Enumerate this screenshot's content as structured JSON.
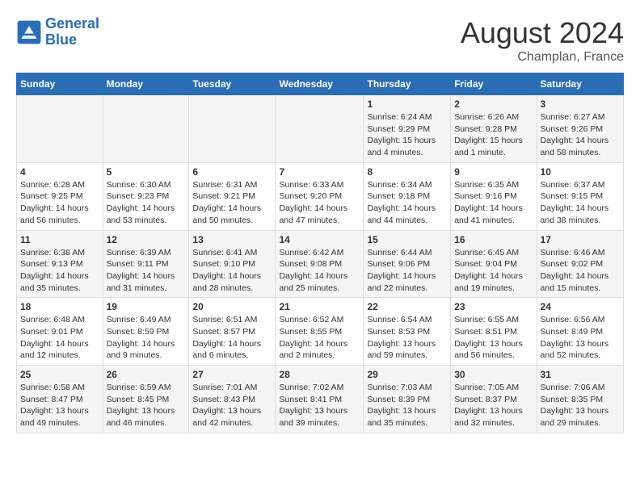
{
  "header": {
    "logo_line1": "General",
    "logo_line2": "Blue",
    "main_title": "August 2024",
    "subtitle": "Champlan, France"
  },
  "days_of_week": [
    "Sunday",
    "Monday",
    "Tuesday",
    "Wednesday",
    "Thursday",
    "Friday",
    "Saturday"
  ],
  "weeks": [
    [
      {
        "day": "",
        "info": ""
      },
      {
        "day": "",
        "info": ""
      },
      {
        "day": "",
        "info": ""
      },
      {
        "day": "",
        "info": ""
      },
      {
        "day": "1",
        "info": "Sunrise: 6:24 AM\nSunset: 9:29 PM\nDaylight: 15 hours\nand 4 minutes."
      },
      {
        "day": "2",
        "info": "Sunrise: 6:26 AM\nSunset: 9:28 PM\nDaylight: 15 hours\nand 1 minute."
      },
      {
        "day": "3",
        "info": "Sunrise: 6:27 AM\nSunset: 9:26 PM\nDaylight: 14 hours\nand 58 minutes."
      }
    ],
    [
      {
        "day": "4",
        "info": "Sunrise: 6:28 AM\nSunset: 9:25 PM\nDaylight: 14 hours\nand 56 minutes."
      },
      {
        "day": "5",
        "info": "Sunrise: 6:30 AM\nSunset: 9:23 PM\nDaylight: 14 hours\nand 53 minutes."
      },
      {
        "day": "6",
        "info": "Sunrise: 6:31 AM\nSunset: 9:21 PM\nDaylight: 14 hours\nand 50 minutes."
      },
      {
        "day": "7",
        "info": "Sunrise: 6:33 AM\nSunset: 9:20 PM\nDaylight: 14 hours\nand 47 minutes."
      },
      {
        "day": "8",
        "info": "Sunrise: 6:34 AM\nSunset: 9:18 PM\nDaylight: 14 hours\nand 44 minutes."
      },
      {
        "day": "9",
        "info": "Sunrise: 6:35 AM\nSunset: 9:16 PM\nDaylight: 14 hours\nand 41 minutes."
      },
      {
        "day": "10",
        "info": "Sunrise: 6:37 AM\nSunset: 9:15 PM\nDaylight: 14 hours\nand 38 minutes."
      }
    ],
    [
      {
        "day": "11",
        "info": "Sunrise: 6:38 AM\nSunset: 9:13 PM\nDaylight: 14 hours\nand 35 minutes."
      },
      {
        "day": "12",
        "info": "Sunrise: 6:39 AM\nSunset: 9:11 PM\nDaylight: 14 hours\nand 31 minutes."
      },
      {
        "day": "13",
        "info": "Sunrise: 6:41 AM\nSunset: 9:10 PM\nDaylight: 14 hours\nand 28 minutes."
      },
      {
        "day": "14",
        "info": "Sunrise: 6:42 AM\nSunset: 9:08 PM\nDaylight: 14 hours\nand 25 minutes."
      },
      {
        "day": "15",
        "info": "Sunrise: 6:44 AM\nSunset: 9:06 PM\nDaylight: 14 hours\nand 22 minutes."
      },
      {
        "day": "16",
        "info": "Sunrise: 6:45 AM\nSunset: 9:04 PM\nDaylight: 14 hours\nand 19 minutes."
      },
      {
        "day": "17",
        "info": "Sunrise: 6:46 AM\nSunset: 9:02 PM\nDaylight: 14 hours\nand 15 minutes."
      }
    ],
    [
      {
        "day": "18",
        "info": "Sunrise: 6:48 AM\nSunset: 9:01 PM\nDaylight: 14 hours\nand 12 minutes."
      },
      {
        "day": "19",
        "info": "Sunrise: 6:49 AM\nSunset: 8:59 PM\nDaylight: 14 hours\nand 9 minutes."
      },
      {
        "day": "20",
        "info": "Sunrise: 6:51 AM\nSunset: 8:57 PM\nDaylight: 14 hours\nand 6 minutes."
      },
      {
        "day": "21",
        "info": "Sunrise: 6:52 AM\nSunset: 8:55 PM\nDaylight: 14 hours\nand 2 minutes."
      },
      {
        "day": "22",
        "info": "Sunrise: 6:54 AM\nSunset: 8:53 PM\nDaylight: 13 hours\nand 59 minutes."
      },
      {
        "day": "23",
        "info": "Sunrise: 6:55 AM\nSunset: 8:51 PM\nDaylight: 13 hours\nand 56 minutes."
      },
      {
        "day": "24",
        "info": "Sunrise: 6:56 AM\nSunset: 8:49 PM\nDaylight: 13 hours\nand 52 minutes."
      }
    ],
    [
      {
        "day": "25",
        "info": "Sunrise: 6:58 AM\nSunset: 8:47 PM\nDaylight: 13 hours\nand 49 minutes."
      },
      {
        "day": "26",
        "info": "Sunrise: 6:59 AM\nSunset: 8:45 PM\nDaylight: 13 hours\nand 46 minutes."
      },
      {
        "day": "27",
        "info": "Sunrise: 7:01 AM\nSunset: 8:43 PM\nDaylight: 13 hours\nand 42 minutes."
      },
      {
        "day": "28",
        "info": "Sunrise: 7:02 AM\nSunset: 8:41 PM\nDaylight: 13 hours\nand 39 minutes."
      },
      {
        "day": "29",
        "info": "Sunrise: 7:03 AM\nSunset: 8:39 PM\nDaylight: 13 hours\nand 35 minutes."
      },
      {
        "day": "30",
        "info": "Sunrise: 7:05 AM\nSunset: 8:37 PM\nDaylight: 13 hours\nand 32 minutes."
      },
      {
        "day": "31",
        "info": "Sunrise: 7:06 AM\nSunset: 8:35 PM\nDaylight: 13 hours\nand 29 minutes."
      }
    ]
  ]
}
